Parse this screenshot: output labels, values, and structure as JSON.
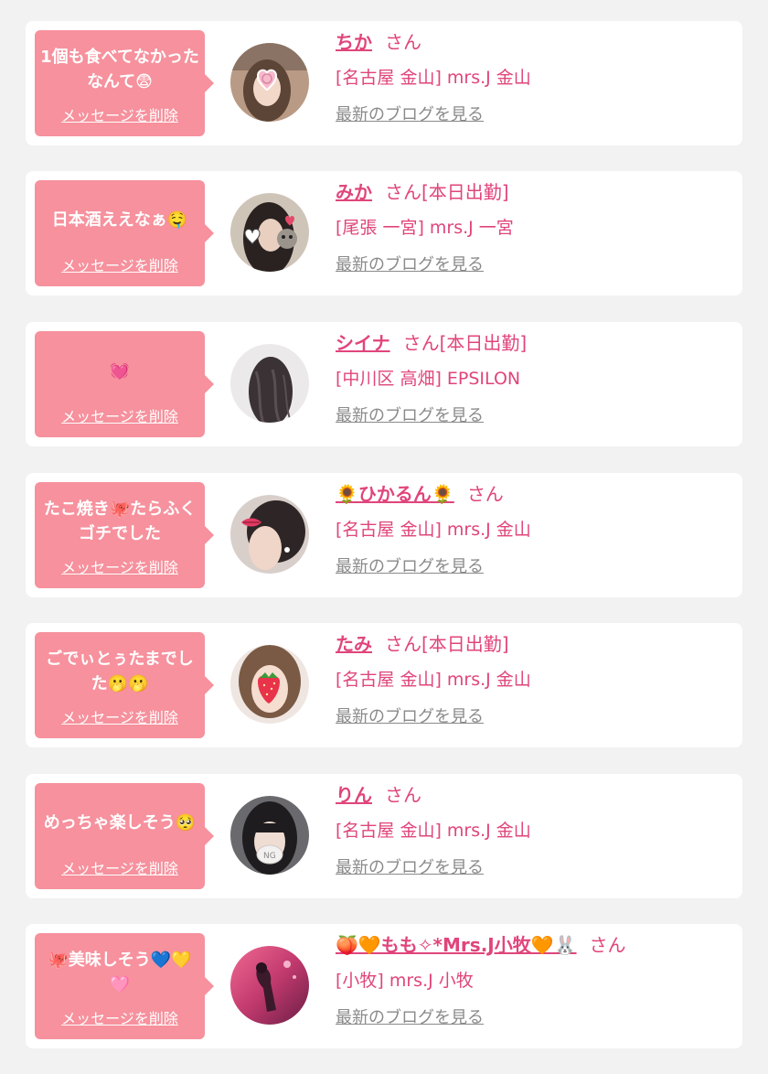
{
  "messages": [
    {
      "message": "1個も食べてなかったなんて😨",
      "delete_label": "メッセージを削除",
      "name": "ちか",
      "suffix": "さん",
      "shop": "[名古屋 金山] mrs.J 金山",
      "blog_label": "最新のブログを見る",
      "avatar_icon": "girl-photo-heart-icon"
    },
    {
      "message": "日本酒ええなぁ🤤",
      "delete_label": "メッセージを削除",
      "name": "みか",
      "suffix": "さん[本日出勤]",
      "shop": "[尾張 一宮] mrs.J 一宮",
      "blog_label": "最新のブログを見る",
      "avatar_icon": "girl-photo-cat-icon"
    },
    {
      "message": "💓",
      "delete_label": "メッセージを削除",
      "name": "シイナ",
      "suffix": "さん[本日出勤]",
      "shop": "[中川区 高畑] EPSILON",
      "blog_label": "最新のブログを見る",
      "avatar_icon": "girl-photo-hair-icon"
    },
    {
      "message": "たこ焼き🐙たらふくゴチでした",
      "delete_label": "メッセージを削除",
      "name": "🌻ひかるん🌻",
      "suffix": "さん",
      "shop": "[名古屋 金山] mrs.J 金山",
      "blog_label": "最新のブログを見る",
      "avatar_icon": "girl-photo-lips-icon"
    },
    {
      "message": "ごでぃとぅたまでした🫢🫢",
      "delete_label": "メッセージを削除",
      "name": "たみ",
      "suffix": "さん[本日出勤]",
      "shop": "[名古屋 金山] mrs.J 金山",
      "blog_label": "最新のブログを見る",
      "avatar_icon": "girl-photo-strawberry-icon"
    },
    {
      "message": "めっちゃ楽しそう🥺",
      "delete_label": "メッセージを削除",
      "name": "りん",
      "suffix": "さん",
      "shop": "[名古屋 金山] mrs.J 金山",
      "blog_label": "最新のブログを見る",
      "avatar_icon": "girl-photo-ng-icon"
    },
    {
      "message": "🐙美味しそう💙💛🩷",
      "delete_label": "メッセージを削除",
      "name": "🍑🧡もも✧*Mrs.J小牧🧡🐰",
      "suffix": "さん",
      "shop": "[小牧] mrs.J 小牧",
      "blog_label": "最新のブログを見る",
      "avatar_icon": "girl-photo-pink-icon"
    }
  ]
}
